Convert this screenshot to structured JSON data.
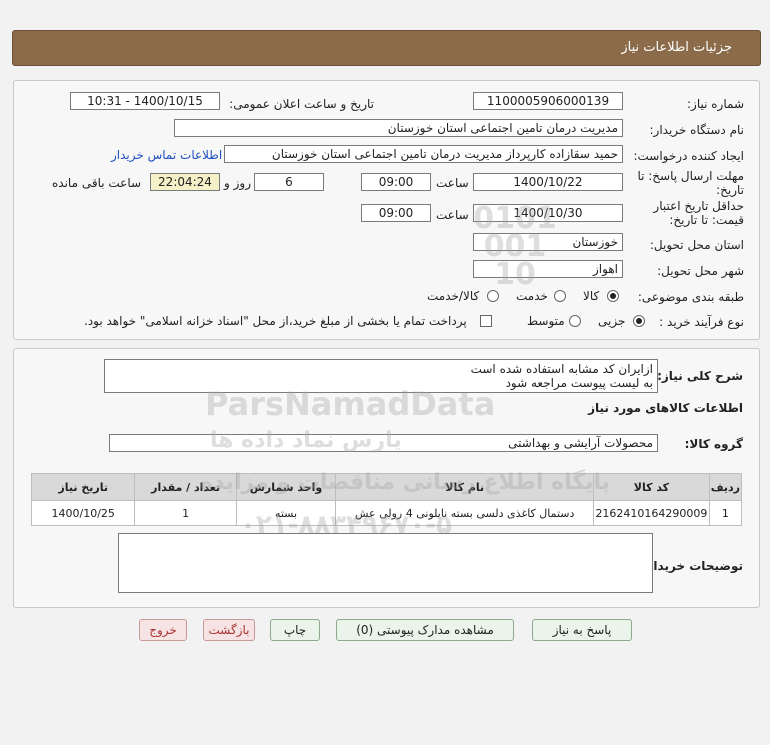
{
  "header": {
    "title": "جزئیات اطلاعات نیاز"
  },
  "form": {
    "need_number_label": "شماره نیاز:",
    "need_number": "1100005906000139",
    "announce_label": "تاریخ و ساعت اعلان عمومی:",
    "announce_value": "1400/10/15 - 10:31",
    "buyer_org_label": "نام دستگاه خریدار:",
    "buyer_org": "مدیریت درمان تامین اجتماعی استان خوزستان",
    "creator_label": "ایجاد کننده درخواست:",
    "creator": "حمید سقازاده کارپرداز مدیریت درمان تامین اجتماعی استان خوزستان",
    "contact_link": "اطلاعات تماس خریدار",
    "deadline_label_1": "مهلت ارسال پاسخ: تا",
    "deadline_label_2": "تاریخ:",
    "deadline_date": "1400/10/22",
    "time_label": "ساعت",
    "deadline_time": "09:00",
    "days_value": "6",
    "days_label": "روز و",
    "remaining_time": "22:04:24",
    "remaining_label": "ساعت باقی مانده",
    "validity_label_1": "حداقل تاریخ اعتبار",
    "validity_label_2": "قیمت: تا تاریخ:",
    "validity_date": "1400/10/30",
    "validity_time": "09:00",
    "province_label": "استان محل تحویل:",
    "province": "خوزستان",
    "city_label": "شهر محل تحویل:",
    "city": "اهواز",
    "category_label": "طبقه بندی موضوعی:",
    "category_options": [
      "کالا",
      "خدمت",
      "کالا/خدمت"
    ],
    "purchase_label": "نوع فرآیند خرید :",
    "purchase_options": [
      "جزیی",
      "متوسط"
    ],
    "payment_note": "پرداخت تمام یا بخشی از مبلغ خرید،از محل \"اسناد خزانه اسلامی\" خواهد بود."
  },
  "description": {
    "label": "شرح کلی نیاز:",
    "line1": "ازایران کد مشابه استفاده شده است",
    "line2": "به لیست پیوست مراجعه شود"
  },
  "goods": {
    "section_title": "اطلاعات کالاهای مورد نیاز",
    "group_label": "گروه کالا:",
    "group_value": "محصولات آرایشی و بهداشتی",
    "columns": [
      "ردیف",
      "کد کالا",
      "نام کالا",
      "واحد شمارش",
      "تعداد / مقدار",
      "تاریخ نیاز"
    ],
    "rows": [
      [
        "1",
        "2162410164290009",
        "دستمال کاغذی دلسی بسته نایلونی 4 رولی عش",
        "بسته",
        "1",
        "1400/10/25"
      ]
    ]
  },
  "buyer_notes": {
    "label": "توضیحات خریدار:"
  },
  "buttons": {
    "reply": "پاسخ به نیاز",
    "attachments": "مشاهده مدارک پیوستی (0)",
    "print": "چاپ",
    "back": "بازگشت",
    "exit": "خروج"
  },
  "watermark": {
    "brand": "ParsNamadData",
    "line1": "پارس نماد داده ها",
    "line2": "پایگاه اطلاع رسانی مناقصات و مزایده",
    "phone": "۰۲۱-۸۸۳۴۹۶۷۰-۵",
    "number": "0101 001 10"
  },
  "colors": {
    "header": "#8b6b4a",
    "link": "#1f4fc4",
    "remaining_bg": "#f5f0c8"
  }
}
